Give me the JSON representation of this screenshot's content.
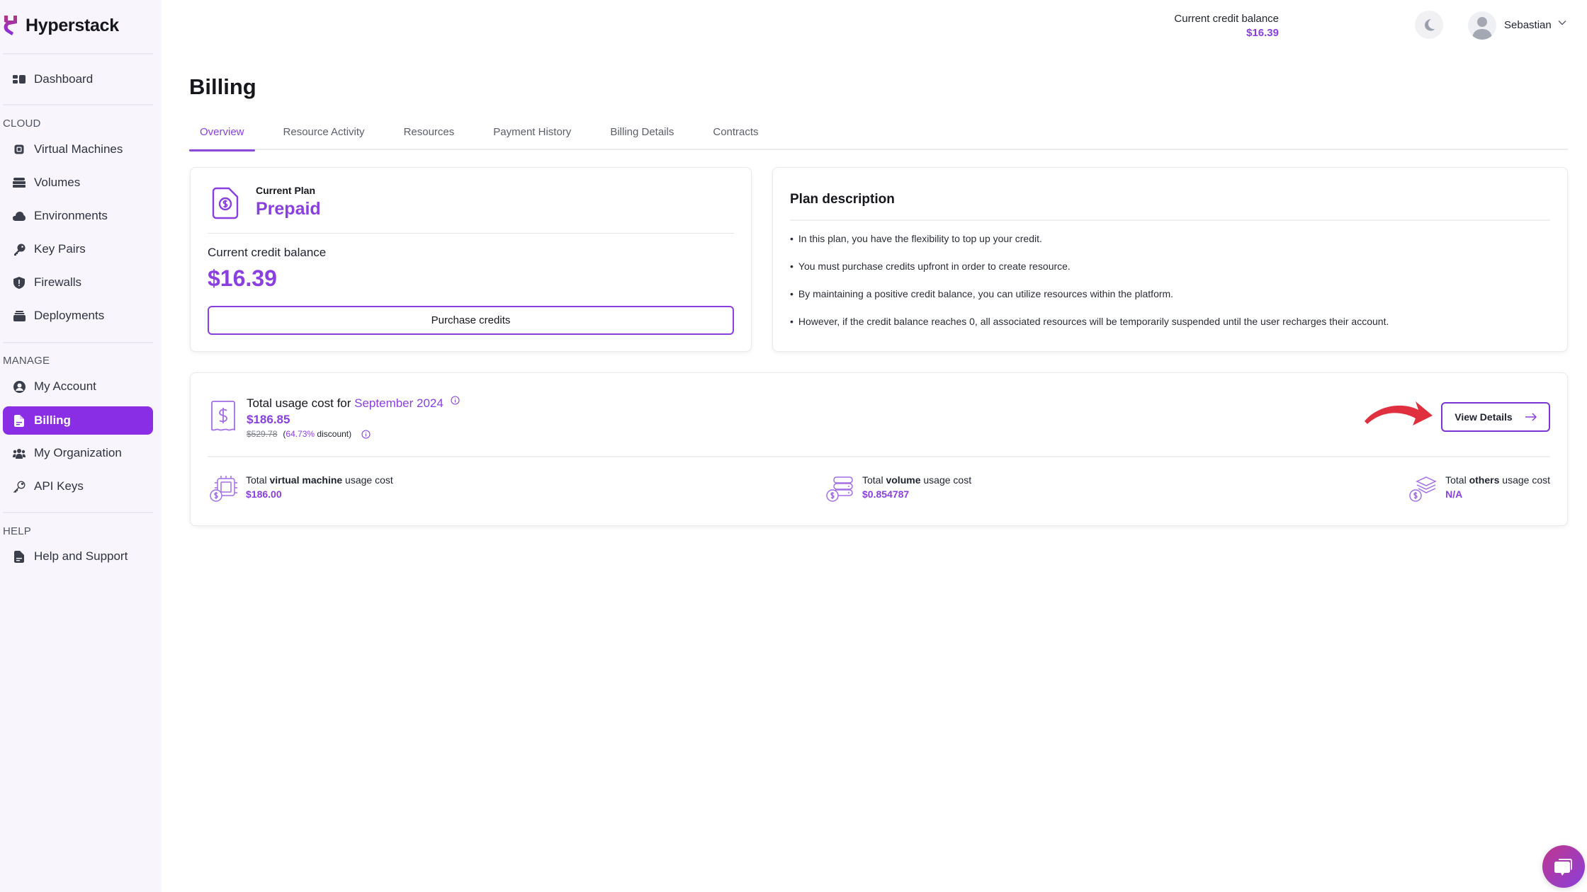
{
  "app": {
    "name": "Hyperstack"
  },
  "sidebar": {
    "dashboard": {
      "label": "Dashboard",
      "icon": "dashboard-icon"
    },
    "sections": [
      {
        "label": "CLOUD",
        "items": [
          {
            "label": "Virtual Machines",
            "icon": "cpu-chip-icon"
          },
          {
            "label": "Volumes",
            "icon": "storage-icon"
          },
          {
            "label": "Environments",
            "icon": "cloud-icon"
          },
          {
            "label": "Key Pairs",
            "icon": "key-icon"
          },
          {
            "label": "Firewalls",
            "icon": "shield-icon"
          },
          {
            "label": "Deployments",
            "icon": "stack-icon"
          }
        ]
      },
      {
        "label": "MANAGE",
        "items": [
          {
            "label": "My Account",
            "icon": "user-circle-icon"
          },
          {
            "label": "Billing",
            "icon": "document-icon",
            "active": true
          },
          {
            "label": "My Organization",
            "icon": "users-icon"
          },
          {
            "label": "API Keys",
            "icon": "key-outline-icon"
          }
        ]
      },
      {
        "label": "HELP",
        "items": [
          {
            "label": "Help and Support",
            "icon": "document-icon"
          }
        ]
      }
    ]
  },
  "topbar": {
    "balance_label": "Current credit balance",
    "balance_value": "$16.39",
    "theme_icon": "moon-icon",
    "user_name": "Sebastian"
  },
  "page": {
    "title": "Billing",
    "tabs": [
      {
        "label": "Overview",
        "active": true
      },
      {
        "label": "Resource Activity"
      },
      {
        "label": "Resources"
      },
      {
        "label": "Payment History"
      },
      {
        "label": "Billing Details"
      },
      {
        "label": "Contracts"
      }
    ]
  },
  "plan": {
    "kicker": "Current Plan",
    "name": "Prepaid",
    "balance_label": "Current credit balance",
    "balance_value": "$16.39",
    "purchase_label": "Purchase credits"
  },
  "description": {
    "title": "Plan description",
    "items": [
      "In this plan, you have the flexibility to top up your credit.",
      "You must purchase credits upfront in order to create resource.",
      "By maintaining a positive credit balance, you can utilize resources within the platform.",
      "However, if the credit balance reaches 0, all associated resources will be temporarily suspended until the user recharges their account."
    ]
  },
  "usage": {
    "title_prefix": "Total usage cost for ",
    "month": "September 2024",
    "total": "$186.85",
    "original": "$529.78",
    "discount_open": "(",
    "discount_pct": "64.73%",
    "discount_close": " discount)",
    "view_details_label": "View Details",
    "stats": [
      {
        "pre": "Total ",
        "bold": "virtual machine",
        "post": " usage cost",
        "value": "$186.00"
      },
      {
        "pre": "Total ",
        "bold": "volume",
        "post": " usage cost",
        "value": "$0.854787"
      },
      {
        "pre": "Total ",
        "bold": "others",
        "post": " usage cost",
        "value": "N/A"
      }
    ]
  },
  "colors": {
    "accent": "#8a3fe0",
    "sidebar_active": "#8a2ee6",
    "annotation_arrow": "#e0303f"
  }
}
